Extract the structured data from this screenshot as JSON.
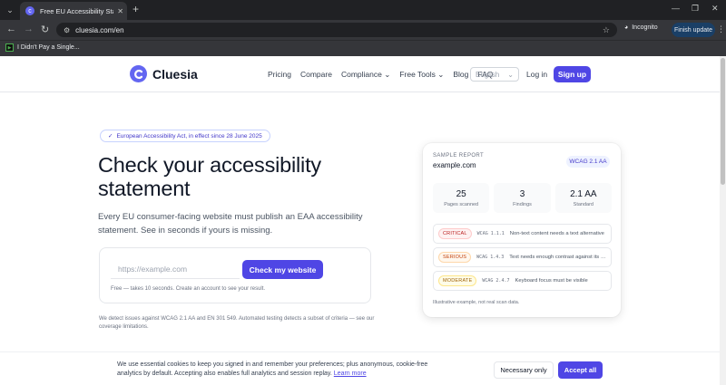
{
  "browser": {
    "tab_title": "Free EU Accessibility Statement",
    "url": "cluesia.com/en",
    "incognito_label": "Incognito",
    "finish_update_label": "Finish update",
    "bookmark_label": "I Didn't Pay a Single..."
  },
  "header": {
    "brand": "Cluesia",
    "nav": [
      "Pricing",
      "Compare",
      "Compliance",
      "Free Tools",
      "Blog",
      "FAQ"
    ],
    "language": "English",
    "login": "Log in",
    "signup": "Sign up"
  },
  "hero": {
    "badge": "European Accessibility Act, in effect since 28 June 2025",
    "title": "Check your accessibility statement",
    "subtitle": "Every EU consumer-facing website must publish an EAA accessibility statement. See in seconds if yours is missing.",
    "input_placeholder": "https://example.com",
    "check_button": "Check my website",
    "form_note": "Free — takes 10 seconds. Create an account to see your result.",
    "disclaimer": "We detect issues against WCAG 2.1 AA and EN 301 549. Automated testing detects a subset of criteria — see our coverage limitations."
  },
  "report": {
    "label": "SAMPLE REPORT",
    "site": "example.com",
    "standard_tag": "WCAG 2.1 AA",
    "stats": [
      {
        "value": "25",
        "label": "Pages scanned"
      },
      {
        "value": "3",
        "label": "Findings"
      },
      {
        "value": "2.1 AA",
        "label": "Standard"
      }
    ],
    "issues": [
      {
        "severity": "CRITICAL",
        "code": "WCAG 1.1.1",
        "text": "Non-text content needs a text alternative"
      },
      {
        "severity": "SERIOUS",
        "code": "WCAG 1.4.3",
        "text": "Text needs enough contrast against its background"
      },
      {
        "severity": "MODERATE",
        "code": "WCAG 2.4.7",
        "text": "Keyboard focus must be visible"
      }
    ],
    "footnote": "Illustrative example, not real scan data."
  },
  "cookie": {
    "text": "We use essential cookies to keep you signed in and remember your preferences; plus anonymous, cookie-free analytics by default. Accepting also enables full analytics and session replay.",
    "learn_more": "Learn more",
    "necessary_button": "Necessary only",
    "accept_button": "Accept all"
  },
  "colors": {
    "brand": "#4f46e5",
    "critical": "#b91c1c",
    "serious": "#c2410c",
    "moderate": "#a16207"
  }
}
